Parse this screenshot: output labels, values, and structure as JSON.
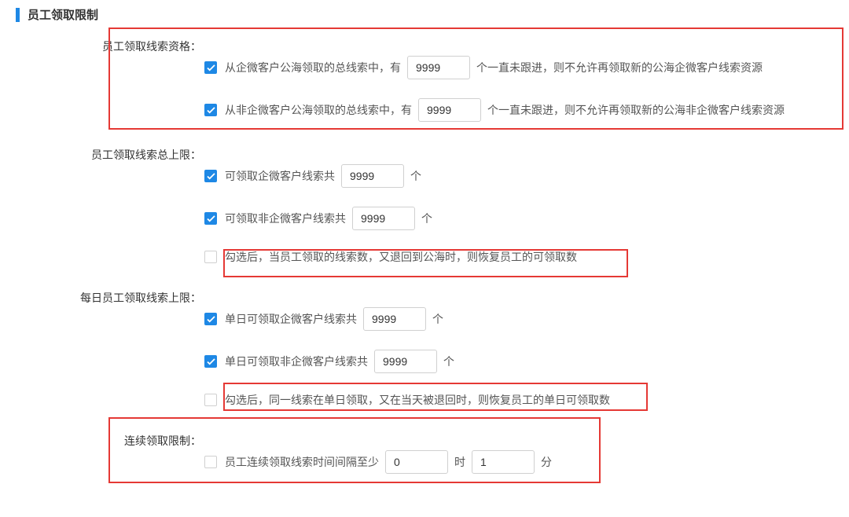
{
  "section_title": "员工领取限制",
  "qualification": {
    "label": "员工领取线索资格：",
    "row1": {
      "checked": true,
      "pre": "从企微客户公海领取的总线索中，有",
      "value": "9999",
      "post": "个一直未跟进，则不允许再领取新的公海企微客户线索资源"
    },
    "row2": {
      "checked": true,
      "pre": "从非企微客户公海领取的总线索中，有",
      "value": "9999",
      "post": "个一直未跟进，则不允许再领取新的公海非企微客户线索资源"
    }
  },
  "total_limit": {
    "label": "员工领取线索总上限：",
    "row1": {
      "checked": true,
      "pre": "可领取企微客户线索共",
      "value": "9999",
      "unit": "个"
    },
    "row2": {
      "checked": true,
      "pre": "可领取非企微客户线索共",
      "value": "9999",
      "unit": "个"
    },
    "row3": {
      "checked": false,
      "text": "勾选后，当员工领取的线索数，又退回到公海时，则恢复员工的可领取数"
    }
  },
  "daily_limit": {
    "label": "每日员工领取线索上限：",
    "row1": {
      "checked": true,
      "pre": "单日可领取企微客户线索共",
      "value": "9999",
      "unit": "个"
    },
    "row2": {
      "checked": true,
      "pre": "单日可领取非企微客户线索共",
      "value": "9999",
      "unit": "个"
    },
    "row3": {
      "checked": false,
      "text": "勾选后，同一线索在单日领取，又在当天被退回时，则恢复员工的单日可领取数"
    }
  },
  "continuous": {
    "label": "连续领取限制：",
    "row1": {
      "checked": false,
      "pre": "员工连续领取线索时间间隔至少",
      "hours": "0",
      "hours_unit": "时",
      "minutes": "1",
      "minutes_unit": "分"
    }
  }
}
